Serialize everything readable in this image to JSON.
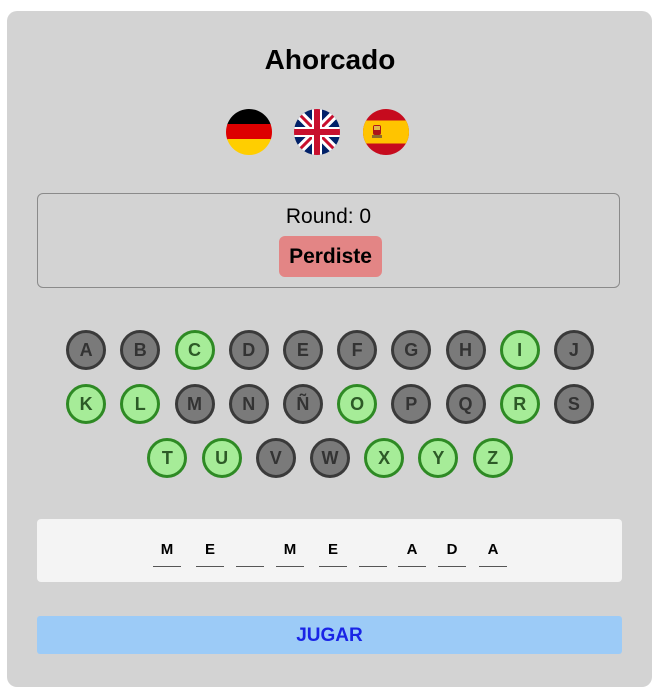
{
  "game": {
    "title": "Ahorcado",
    "round_text": "Round: 0",
    "result": "Perdiste",
    "play_label": "JUGAR"
  },
  "languages": [
    {
      "name": "german-flag-icon",
      "selected": false
    },
    {
      "name": "uk-flag-icon",
      "selected": false
    },
    {
      "name": "spain-flag-icon",
      "selected": true
    }
  ],
  "keyboard": {
    "rows": [
      [
        {
          "letter": "A",
          "state": "unused"
        },
        {
          "letter": "B",
          "state": "unused"
        },
        {
          "letter": "C",
          "state": "correct"
        },
        {
          "letter": "D",
          "state": "unused"
        },
        {
          "letter": "E",
          "state": "unused"
        },
        {
          "letter": "F",
          "state": "unused"
        },
        {
          "letter": "G",
          "state": "unused"
        },
        {
          "letter": "H",
          "state": "unused"
        },
        {
          "letter": "I",
          "state": "correct"
        },
        {
          "letter": "J",
          "state": "unused"
        }
      ],
      [
        {
          "letter": "K",
          "state": "correct"
        },
        {
          "letter": "L",
          "state": "correct"
        },
        {
          "letter": "M",
          "state": "unused"
        },
        {
          "letter": "N",
          "state": "unused"
        },
        {
          "letter": "Ñ",
          "state": "unused"
        },
        {
          "letter": "O",
          "state": "correct"
        },
        {
          "letter": "P",
          "state": "unused"
        },
        {
          "letter": "Q",
          "state": "unused"
        },
        {
          "letter": "R",
          "state": "correct"
        },
        {
          "letter": "S",
          "state": "unused"
        }
      ],
      [
        {
          "letter": "T",
          "state": "correct"
        },
        {
          "letter": "U",
          "state": "correct"
        },
        {
          "letter": "V",
          "state": "unused"
        },
        {
          "letter": "W",
          "state": "unused"
        },
        {
          "letter": "X",
          "state": "correct"
        },
        {
          "letter": "Y",
          "state": "correct"
        },
        {
          "letter": "Z",
          "state": "correct"
        }
      ]
    ]
  },
  "word_slots": [
    "M",
    "E",
    "",
    "M",
    "E",
    "",
    "A",
    "D",
    "A"
  ]
}
